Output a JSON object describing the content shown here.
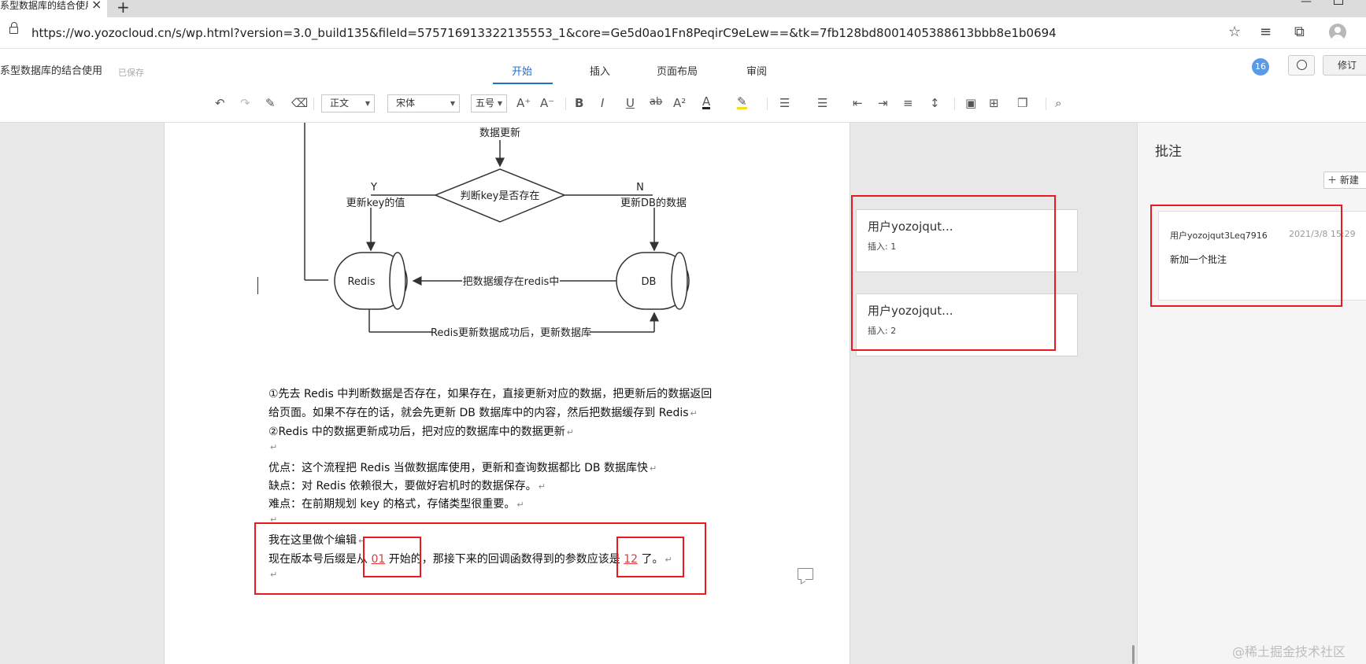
{
  "browser": {
    "tab_title": "系型数据库的结合使用",
    "tab_close": "×",
    "new_tab": "+",
    "url": "https://wo.yozocloud.cn/s/wp.html?version=3.0_build135&fileId=575716913322135553_1&core=Ge5d0ao1Fn8PeqirC9eLew==&tk=7fb128bd8001405388613bbb8e1b0694"
  },
  "app": {
    "doc_title": "系型数据库的结合使用",
    "save_status": "已保存",
    "tabs": [
      "开始",
      "插入",
      "页面布局",
      "审阅"
    ],
    "active_tab": "开始",
    "comment_count": "16",
    "revise_label": "修订"
  },
  "toolbar": {
    "style_value": "正文",
    "font_value": "宋体",
    "size_value": "五号"
  },
  "flowchart": {
    "top_label": "数据更新",
    "decision": "判断key是否存在",
    "yes_mark": "Y",
    "yes_label": "更新key的值",
    "no_mark": "N",
    "no_label": "更新DB的数据",
    "redis_label": "Redis",
    "db_label": "DB",
    "cache_label": "把数据缓存在redis中",
    "bottom_label": "Redis更新数据成功后，更新数据库"
  },
  "document": {
    "p1a": "①先去 Redis 中判断数据是否存在，如果存在，直接更新对应的数据，把更新后的数据返回",
    "p1b": "给页面。如果不存在的话，就会先更新 DB 数据库中的内容，然后把数据缓存到 Redis",
    "p2": "②Redis 中的数据更新成功后，把对应的数据库中的数据更新",
    "adv": "优点：这个流程把 Redis 当做数据库使用，更新和查询数据都比 DB 数据库快",
    "dis": "缺点：对 Redis 依赖很大，要做好宕机时的数据保存。",
    "diff": "难点：在前期规划 key 的格式，存储类型很重要。",
    "edit1": "我在这里做个编辑",
    "edit2_a": "现在版本号后缀是从 ",
    "edit2_num1": "01",
    "edit2_b": " 开始的，那接下来的回调函数得到的参数应该是 ",
    "edit2_num2": "12",
    "edit2_c": " 了。",
    "return_mark": "↵"
  },
  "comment_cards": [
    {
      "user": "用户yozojqut...",
      "detail": "插入: 1"
    },
    {
      "user": "用户yozojqut...",
      "detail": "插入: 2"
    }
  ],
  "side_panel": {
    "title": "批注",
    "new_label": "新建",
    "card": {
      "user": "用户yozojqut3Leq7916",
      "date": "2021/3/8 15:29",
      "text": "新加一个批注"
    }
  },
  "watermark": "@稀土掘金技术社区",
  "colors": {
    "accent": "#1f6fcf",
    "highlight_box": "#e8191f"
  }
}
